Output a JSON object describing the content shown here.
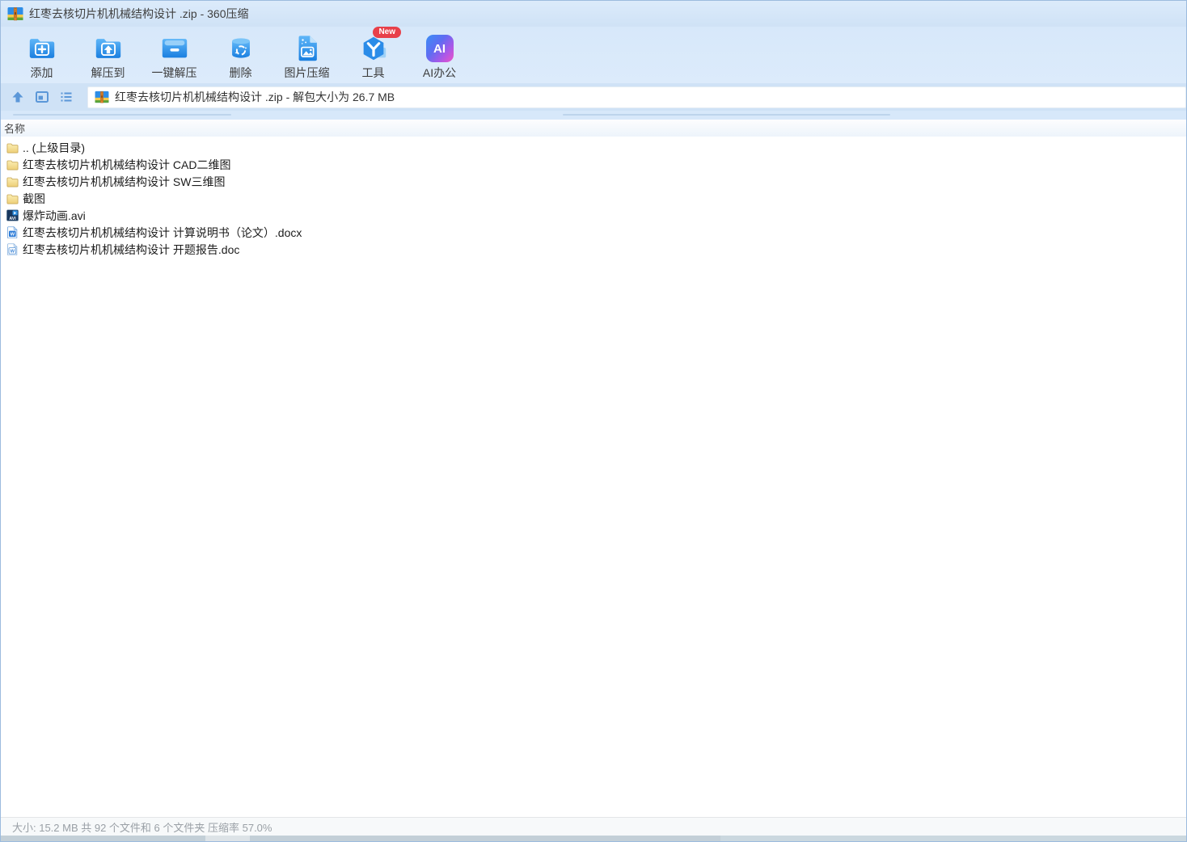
{
  "window": {
    "title": "红枣去核切片机机械结构设计 .zip - 360压缩",
    "app_name": "360压缩"
  },
  "toolbar": {
    "buttons": [
      {
        "label": "添加",
        "icon": "add-folder-icon"
      },
      {
        "label": "解压到",
        "icon": "extract-to-icon"
      },
      {
        "label": "一键解压",
        "icon": "one-click-extract-icon"
      },
      {
        "label": "删除",
        "icon": "delete-trash-icon"
      },
      {
        "label": "图片压缩",
        "icon": "image-compress-icon"
      },
      {
        "label": "工具",
        "icon": "tools-cube-icon",
        "badge": "New"
      },
      {
        "label": "AI办公",
        "icon": "ai-office-icon",
        "icon_text": "AI"
      }
    ]
  },
  "addressbar": {
    "path_text": "红枣去核切片机机械结构设计 .zip - 解包大小为 26.7 MB",
    "nav_icons": [
      "up-icon",
      "icon-view-icon",
      "list-view-icon"
    ]
  },
  "filelist": {
    "header": "名称",
    "rows": [
      {
        "name": ".. (上级目录)",
        "type": "folder"
      },
      {
        "name": "红枣去核切片机机械结构设计 CAD二维图",
        "type": "folder"
      },
      {
        "name": "红枣去核切片机机械结构设计 SW三维图",
        "type": "folder"
      },
      {
        "name": "截图",
        "type": "folder"
      },
      {
        "name": "爆炸动画.avi",
        "type": "avi"
      },
      {
        "name": "红枣去核切片机机械结构设计 计算说明书（论文）.docx",
        "type": "docx"
      },
      {
        "name": "红枣去核切片机机械结构设计 开题报告.doc",
        "type": "doc"
      }
    ]
  },
  "statusbar": {
    "text": "大小: 15.2 MB 共 92 个文件和 6 个文件夹 压缩率 57.0%"
  },
  "colors": {
    "accent_blue": "#2a8ce8",
    "chrome_blue": "#d7e8fa",
    "badge_red": "#e8404a",
    "folder_yellow": "#f3dd96",
    "ai_gradient": [
      "#3a8ef5",
      "#6d5ef0",
      "#ef53c6"
    ]
  }
}
